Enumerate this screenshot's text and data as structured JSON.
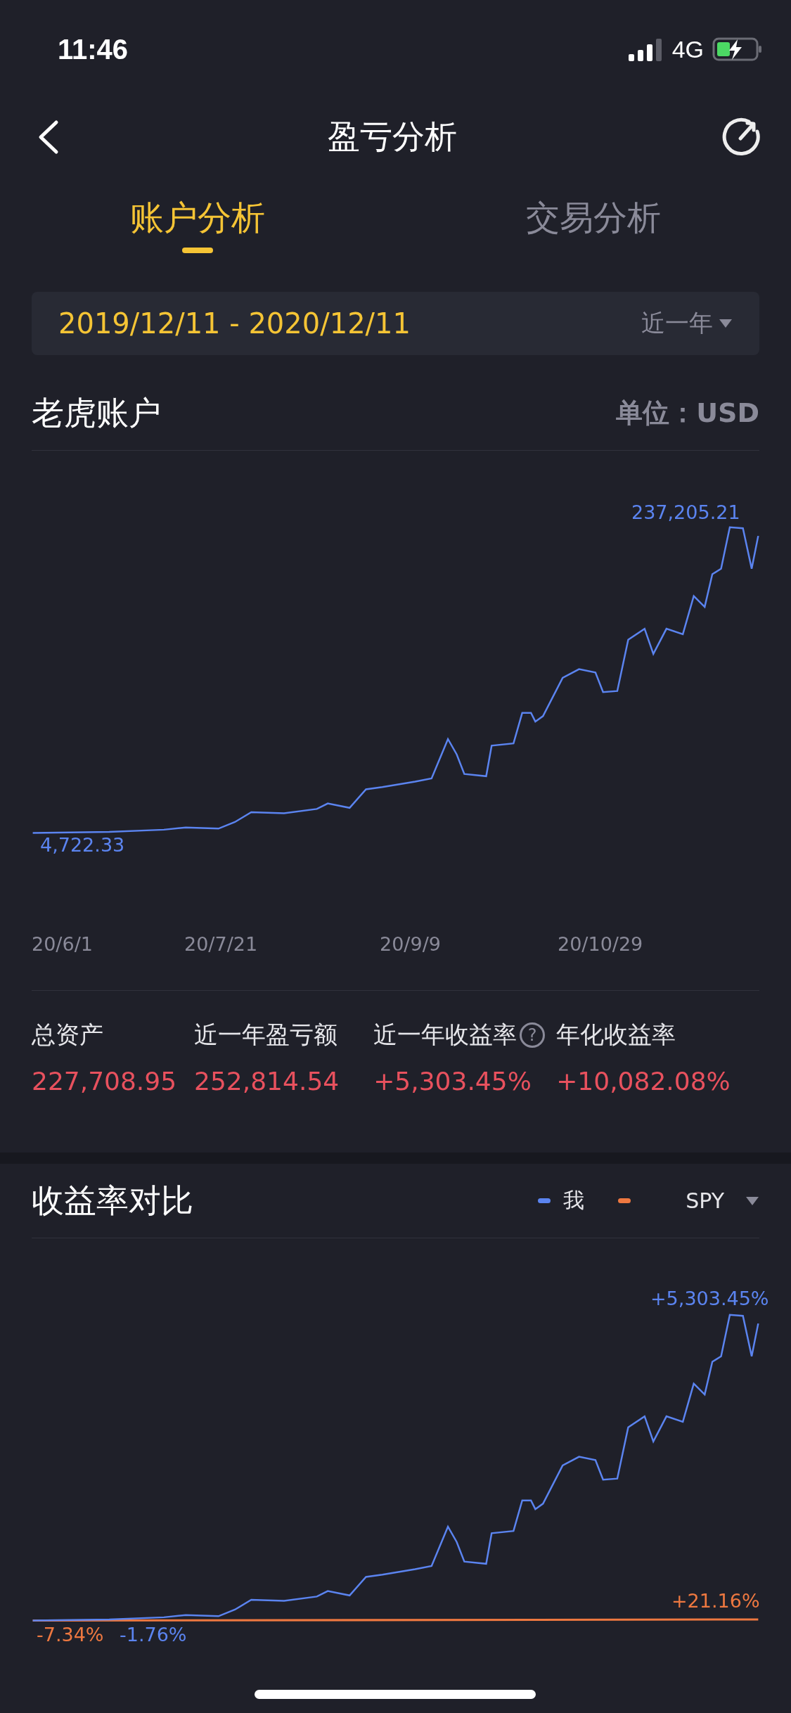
{
  "status_bar": {
    "time": "11:46",
    "network": "4G"
  },
  "header": {
    "title": "盈亏分析"
  },
  "tabs": [
    {
      "label": "账户分析",
      "selected": true
    },
    {
      "label": "交易分析",
      "selected": false
    }
  ],
  "date_range": {
    "value": "2019/12/11 - 2020/12/11",
    "period": "近一年"
  },
  "account": {
    "title": "老虎账户",
    "unit": "单位：USD",
    "max_label": "237,205.21",
    "min_label": "4,722.33",
    "x_labels": [
      "20/6/1",
      "20/7/21",
      "20/9/9",
      "20/10/29"
    ]
  },
  "stats": [
    {
      "label": "总资产",
      "value": "227,708.95"
    },
    {
      "label": "近一年盈亏额",
      "value": "252,814.54"
    },
    {
      "label": "近一年收益率",
      "value": "+5,303.45%",
      "help": "?"
    },
    {
      "label": "年化收益率",
      "value": "+10,082.08%"
    }
  ],
  "comparison": {
    "title": "收益率对比",
    "legend": [
      {
        "label": "我",
        "color": "#5b84f0",
        "kind": "plain"
      },
      {
        "label": "SPY",
        "color": "#ee7840",
        "kind": "dropdown"
      }
    ],
    "end_labels": [
      {
        "text": "+5,303.45%",
        "color": "#5b84f0"
      },
      {
        "text": "+21.16%",
        "color": "#ee7840"
      }
    ],
    "start_labels": [
      {
        "text": "-7.34%",
        "color": "#ee7840"
      },
      {
        "text": "-1.76%",
        "color": "#5b84f0"
      }
    ]
  }
}
